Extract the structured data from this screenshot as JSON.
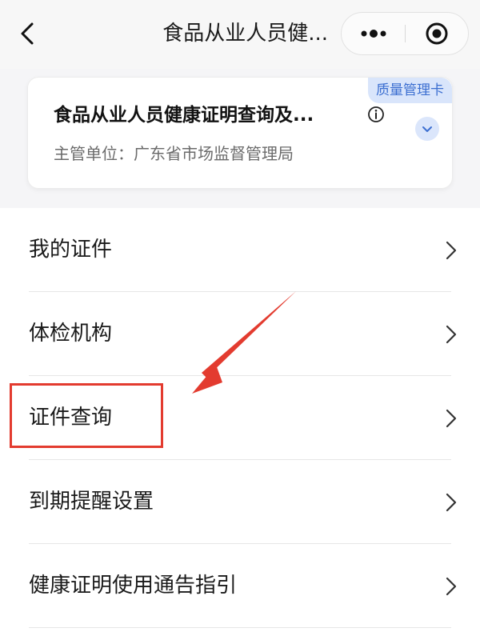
{
  "nav": {
    "back_icon": "chevron-left-icon",
    "title": "食品从业人员健...",
    "more_icon": "more-dots-icon",
    "close_icon": "target-close-icon"
  },
  "card": {
    "tag": "质量管理卡",
    "title": "食品从业人员健康证明查询及...",
    "subtitle": "主管单位：广东省市场监督管理局",
    "info_icon": "info-icon",
    "expand_icon": "chevron-down-icon"
  },
  "menu": {
    "items": [
      {
        "label": "我的证件"
      },
      {
        "label": "体检机构"
      },
      {
        "label": "证件查询"
      },
      {
        "label": "到期提醒设置"
      },
      {
        "label": "健康证明使用通告指引"
      }
    ]
  },
  "annotation": {
    "color": "#e33b2f"
  },
  "colors": {
    "accent": "#3c6fd1",
    "tag_bg": "#d9e5fb"
  }
}
